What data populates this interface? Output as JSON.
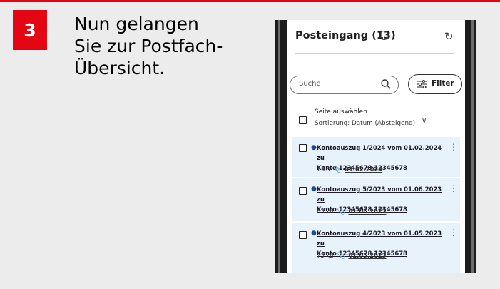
{
  "step": {
    "number": "3",
    "lines": [
      "Nun gelangen",
      "Sie zur Postfach-",
      "Übersicht."
    ]
  },
  "phone": {
    "title": "Posteingang (13)",
    "search_placeholder": "Suche",
    "filter_label": "Filter",
    "select_all": {
      "label": "Seite auswählen",
      "sort": "Sortierung: Datum (Absteigend)"
    },
    "messages": [
      {
        "title_line1": "Kontoauszug 1/2024 vom 01.02.2024 zu",
        "title_line2": "Konto 12345678  12345678",
        "size": "1 kB",
        "date": "01.02.2024"
      },
      {
        "title_line1": "Kontoauszug 5/2023 vom 01.06.2023 zu",
        "title_line2": "Konto 12345678  12345678",
        "size": "63 kB",
        "date": "01.06.2023"
      },
      {
        "title_line1": "Kontoauszug 4/2023 vom 01.05.2023 zu",
        "title_line2": "Konto 12345678  12345678",
        "size": "73 kB",
        "date": "01.05.2023"
      }
    ]
  },
  "colors": {
    "accent": "#e30613",
    "background": "#ececec",
    "item_background": "#e8f2fb"
  },
  "icons": [
    "info-icon",
    "refresh-icon",
    "search-icon",
    "filter-icon",
    "chevron-down-icon",
    "paperclip-icon",
    "kebab-menu-icon"
  ]
}
